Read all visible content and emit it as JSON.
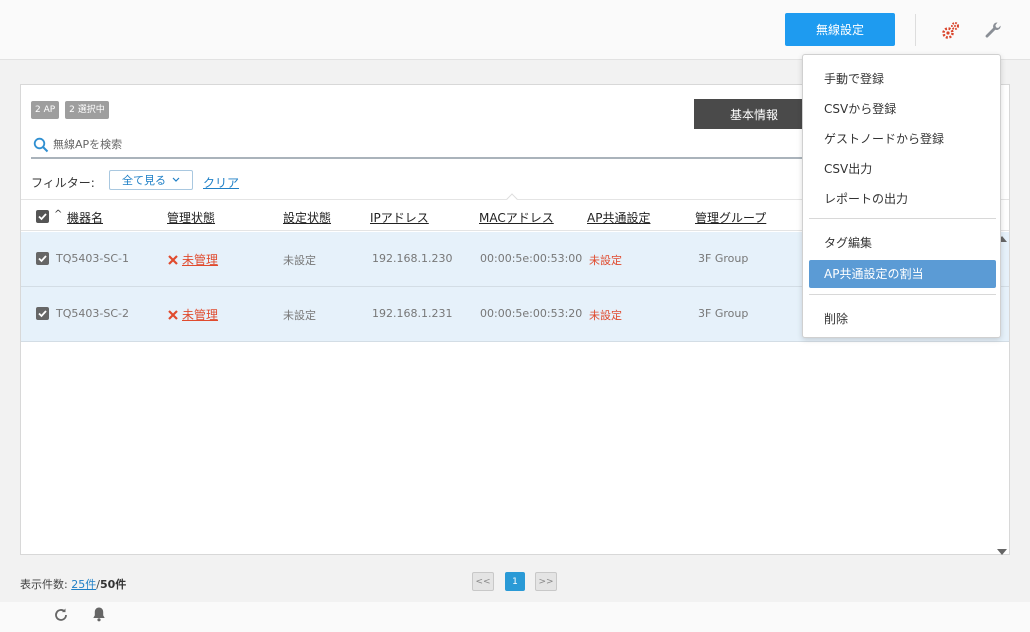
{
  "header": {
    "wireless_settings_label": "無線設定"
  },
  "badges": {
    "ap_count": "2 AP",
    "selected_count": "2 選択中"
  },
  "tabs": {
    "basic_info": "基本情報"
  },
  "search": {
    "placeholder": "無線APを検索"
  },
  "filter": {
    "label": "フィルター:",
    "select_value": "全て見る",
    "clear_label": "クリア"
  },
  "table": {
    "sort_indicator": "^",
    "columns": {
      "name": "機器名",
      "mgmt_status": "管理状態",
      "config_status": "設定状態",
      "ip": "IPアドレス",
      "mac": "MACアドレス",
      "ap_common": "AP共通設定",
      "mgmt_group": "管理グループ"
    },
    "rows": [
      {
        "name": "TQ5403-SC-1",
        "mgmt_status": "未管理",
        "config_status": "未設定",
        "ip": "192.168.1.230",
        "mac": "00:00:5e:00:53:00",
        "ap_common": "未設定",
        "mgmt_group": "3F Group"
      },
      {
        "name": "TQ5403-SC-2",
        "mgmt_status": "未管理",
        "config_status": "未設定",
        "ip": "192.168.1.231",
        "mac": "00:00:5e:00:53:20",
        "ap_common": "未設定",
        "mgmt_group": "3F Group"
      }
    ]
  },
  "menu": {
    "items": [
      "手動で登録",
      "CSVから登録",
      "ゲストノードから登録",
      "CSV出力",
      "レポートの出力",
      "タグ編集",
      "AP共通設定の割当",
      "削除"
    ]
  },
  "footer": {
    "count_label": "表示件数:",
    "per_page": "25件",
    "separator": "/",
    "total": "50件",
    "prev": "<<",
    "page": "1",
    "next": ">>"
  },
  "colors": {
    "primary": "#1e9bf0",
    "danger": "#e04b2e",
    "row_selected": "#e6f1fa",
    "menu_active": "#5b9bd5"
  }
}
